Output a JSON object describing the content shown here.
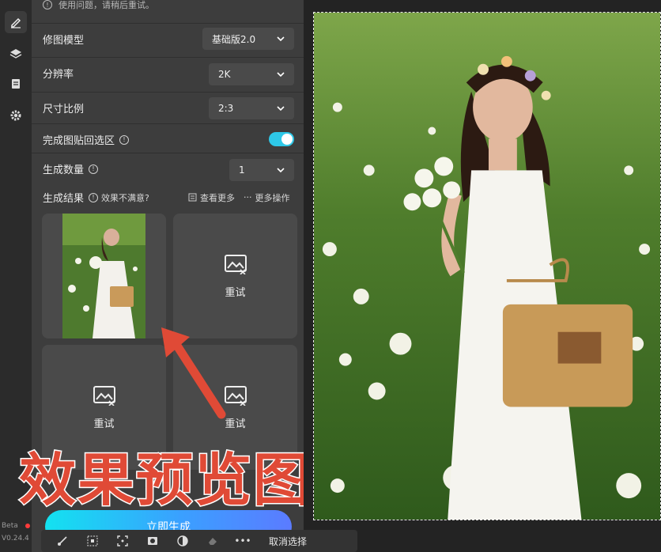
{
  "notice": {
    "text": "使用问题，请稍后重试。",
    "icon": "info-icon"
  },
  "rail": {
    "items": [
      {
        "icon": "edit-icon",
        "active": true
      },
      {
        "icon": "layers-icon",
        "active": false
      },
      {
        "icon": "document-icon",
        "active": false
      },
      {
        "icon": "gear-icon",
        "active": false
      }
    ],
    "beta": "Beta",
    "version": "V0.24.4"
  },
  "settings": {
    "model": {
      "label": "修图模型",
      "value": "基础版2.0"
    },
    "resolution": {
      "label": "分辨率",
      "value": "2K"
    },
    "ratio": {
      "label": "尺寸比例",
      "value": "2:3"
    },
    "paste_back": {
      "label": "完成图贴回选区",
      "enabled": true
    },
    "count": {
      "label": "生成数量",
      "value": "1"
    }
  },
  "results": {
    "label": "生成结果",
    "unsatisfied": "效果不满意?",
    "view_more": "查看更多",
    "more_actions": "更多操作",
    "cards": [
      {
        "type": "image"
      },
      {
        "type": "retry",
        "label": "重试"
      },
      {
        "type": "retry",
        "label": "重试"
      },
      {
        "type": "retry",
        "label": "重试"
      }
    ]
  },
  "overlay": {
    "text": "效果预览图",
    "color": "#e04a36"
  },
  "generate_button": {
    "label": "立即生成"
  },
  "toolbar": {
    "cancel_selection": "取消选择"
  },
  "colors": {
    "accent": "#2ec8e8",
    "panel": "#3d3d3d"
  }
}
